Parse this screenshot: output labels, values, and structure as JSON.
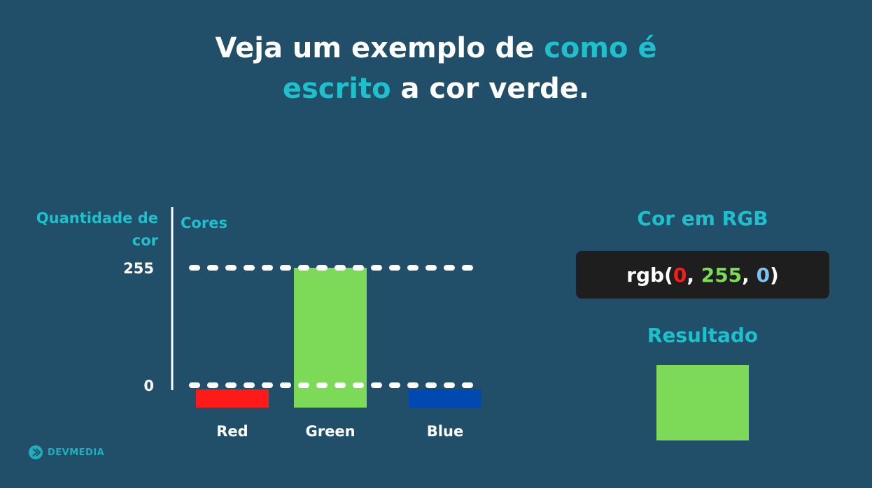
{
  "title": {
    "part1": "Veja um exemplo de ",
    "accent1": "como é",
    "accent2": "escrito",
    "part2": " a cor verde."
  },
  "chart_data": {
    "type": "bar",
    "xlabel": "Cores",
    "ylabel": "Quantidade de cor",
    "categories": [
      "Red",
      "Green",
      "Blue"
    ],
    "values": [
      0,
      255,
      0
    ],
    "colors": [
      "#ff1a1a",
      "#7dda58",
      "#0049b0"
    ],
    "ylim": [
      0,
      255
    ],
    "ticks": [
      0,
      255
    ],
    "grid": true
  },
  "rgb": {
    "heading": "Cor em RGB",
    "prefix": "rgb(",
    "r": "0",
    "sep1": ", ",
    "g": "255",
    "sep2": ", ",
    "b": "0",
    "suffix": ")",
    "r_color": "#ff1a1a",
    "g_color": "#7dda58",
    "b_color": "#7cc3f5"
  },
  "result": {
    "heading": "Resultado",
    "color": "#7dda58"
  },
  "logo": {
    "text": "DEVMEDIA",
    "icon": "devmedia-logo-icon"
  }
}
